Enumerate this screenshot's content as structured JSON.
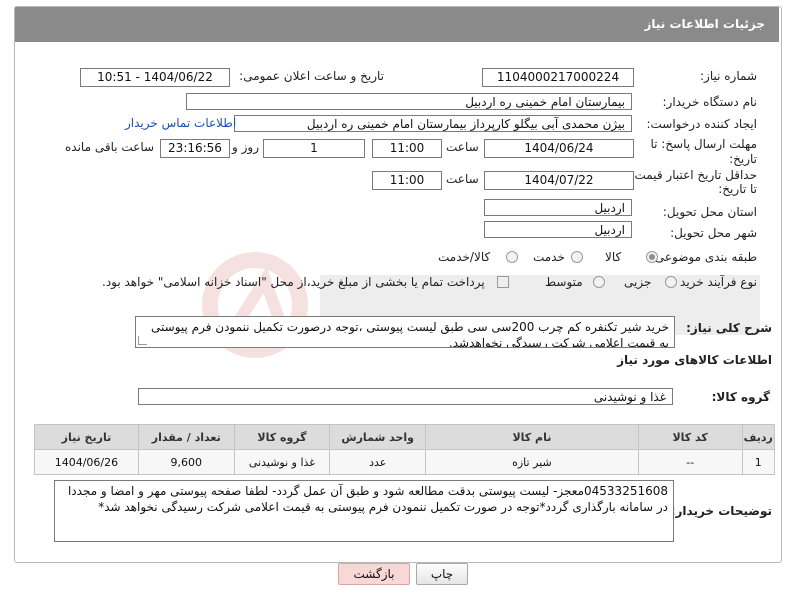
{
  "header": {
    "title": "جزئیات اطلاعات نیاز"
  },
  "fields": {
    "need_number_label": "شماره نیاز:",
    "need_number": "1104000217000224",
    "announce_label": "تاریخ و ساعت اعلان عمومی:",
    "announce_value": "1404/06/22 - 10:51",
    "buyer_org_label": "نام دستگاه خریدار:",
    "buyer_org": "بیمارستان امام خمینی  ره  اردبیل",
    "requester_label": "ایجاد کننده درخواست:",
    "requester": "بیژن محمدی آبی بیگلو کارپرداز بیمارستان امام خمینی  ره  اردبیل",
    "contact_link": "اطلاعات تماس خریدار",
    "deadline_label_1": "مهلت ارسال پاسخ: تا",
    "deadline_label_2": "تاریخ:",
    "deadline_date": "1404/06/24",
    "time_label": "ساعت",
    "deadline_time": "11:00",
    "days_value": "1",
    "days_label": "روز و",
    "remaining_time": "23:16:56",
    "remaining_label": "ساعت باقی مانده",
    "validity_label_1": "حداقل تاریخ اعتبار قیمت:",
    "validity_label_2": "تا تاریخ:",
    "validity_date": "1404/07/22",
    "validity_time": "11:00",
    "province_label": "استان محل تحویل:",
    "province": "اردبیل",
    "city_label": "شهر محل تحویل:",
    "city": "اردبیل",
    "category_label": "طبقه بندی موضوعی:",
    "category_options": [
      "کالا",
      "خدمت",
      "کالا/خدمت"
    ],
    "category_selected": "کالا",
    "process_label": "نوع فرآیند خرید :",
    "process_options": [
      "جزیی",
      "متوسط"
    ],
    "process_note": "پرداخت تمام یا بخشی از مبلغ خرید،از محل \"اسناد خزانه اسلامی\" خواهد بود."
  },
  "summary": {
    "label": "شرح کلی نیاز:",
    "text": "خرید شیر تکنفره کم چرب 200سی سی طبق لیست پیوستی ،توجه درصورت تکمیل ننمودن فرم پیوستی به قیمت اعلامی شرکت رسیدگی نخواهدشد."
  },
  "goods_section": {
    "title": "اطلاعات کالاهای مورد نیاز",
    "group_label": "گروه کالا:",
    "group_value": "غذا و نوشیدنی"
  },
  "table": {
    "headers": [
      "ردیف",
      "کد کالا",
      "نام کالا",
      "واحد شمارش",
      "گروه کالا",
      "تعداد / مقدار",
      "تاریخ نیاز"
    ],
    "rows": [
      [
        "1",
        "--",
        "شیر تازه",
        "عدد",
        "غذا و نوشیدنی",
        "9,600",
        "1404/06/26"
      ]
    ]
  },
  "buyer_notes": {
    "label": "توضیحات خریدار:",
    "text": "04533251608معجز- لیست پیوستی بدقت مطالعه شود و طبق آن عمل گردد- لطفا صفحه پیوستی مهر و امضا و مجددا در سامانه بارگذاری گردد*توجه در صورت تکمیل ننمودن فرم پیوستی به قیمت اعلامی شرکت رسیدگی نخواهد شد*"
  },
  "buttons": {
    "print": "چاپ",
    "back": "بازگشت"
  },
  "colors": {
    "header_bg": "#8a8a8a",
    "link": "#1a4fb3",
    "back_btn_bg": "#f8d7d7"
  }
}
